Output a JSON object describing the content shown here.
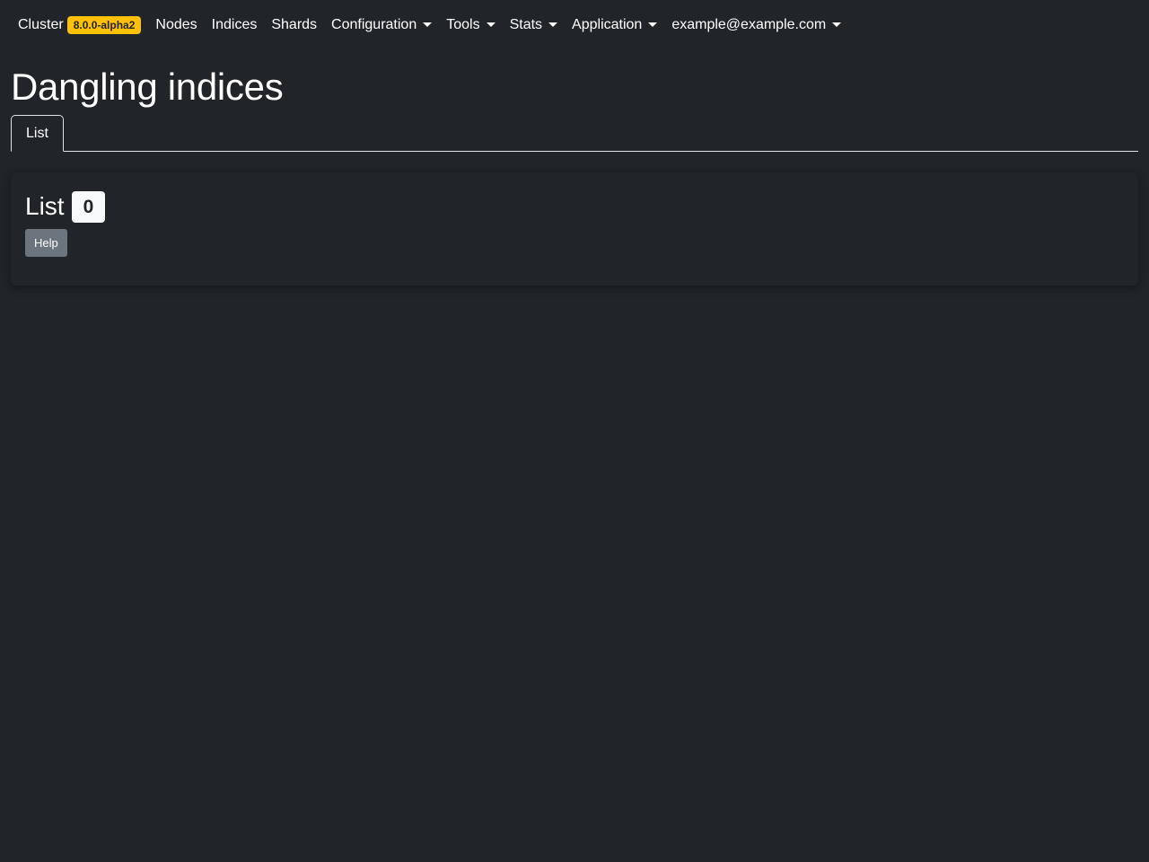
{
  "navbar": {
    "brand_label": "Cluster",
    "version": "8.0.0-alpha2",
    "items": [
      {
        "label": "Nodes"
      },
      {
        "label": "Indices"
      },
      {
        "label": "Shards"
      },
      {
        "label": "Configuration"
      },
      {
        "label": "Tools"
      },
      {
        "label": "Stats"
      },
      {
        "label": "Application"
      },
      {
        "label": "example@example.com"
      }
    ]
  },
  "page": {
    "title": "Dangling indices"
  },
  "tabs": [
    {
      "label": "List",
      "active": true
    }
  ],
  "card": {
    "title": "List",
    "count": "0",
    "help_label": "Help"
  },
  "colors": {
    "background": "#212529",
    "text": "#ffffff",
    "version_badge": "#ffc107",
    "count_badge": "#f8f9fa",
    "help_button": "#6c757d",
    "tab_border": "#dee2e6"
  }
}
